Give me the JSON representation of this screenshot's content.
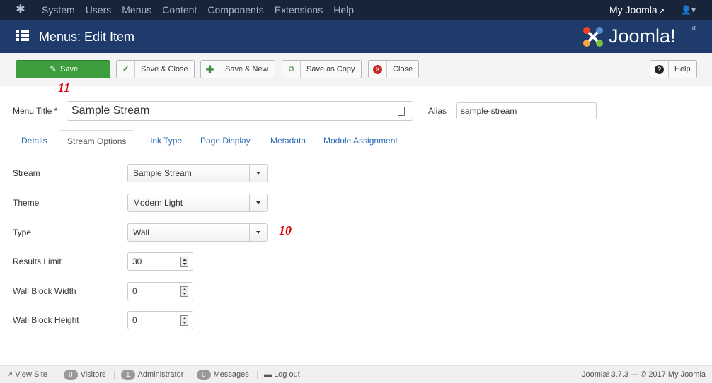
{
  "topnav": {
    "menu": [
      "System",
      "Users",
      "Menus",
      "Content",
      "Components",
      "Extensions",
      "Help"
    ],
    "site_link": "My Joomla",
    "icons": {
      "logo": "joomla-logo-icon",
      "external": "external-link-icon",
      "user": "user-icon"
    }
  },
  "header": {
    "title": "Menus: Edit Item",
    "brand": "Joomla!"
  },
  "toolbar": {
    "save": "Save",
    "save_close": "Save & Close",
    "save_new": "Save & New",
    "save_copy": "Save as Copy",
    "close": "Close",
    "help": "Help"
  },
  "annotations": {
    "save_marker": "11",
    "type_marker": "10"
  },
  "form": {
    "menu_title_label": "Menu Title *",
    "menu_title_value": "Sample Stream",
    "alias_label": "Alias",
    "alias_value": "sample-stream"
  },
  "tabs": [
    "Details",
    "Stream Options",
    "Link Type",
    "Page Display",
    "Metadata",
    "Module Assignment"
  ],
  "active_tab": "Stream Options",
  "options": {
    "stream": {
      "label": "Stream",
      "value": "Sample Stream"
    },
    "theme": {
      "label": "Theme",
      "value": "Modern Light"
    },
    "type": {
      "label": "Type",
      "value": "Wall"
    },
    "results_limit": {
      "label": "Results Limit",
      "value": "30"
    },
    "wall_block_width": {
      "label": "Wall Block Width",
      "value": "0"
    },
    "wall_block_height": {
      "label": "Wall Block Height",
      "value": "0"
    }
  },
  "status": {
    "view_site": "View Site",
    "visitors_count": "0",
    "visitors": "Visitors",
    "admin_count": "1",
    "admin": "Administrator",
    "messages_count": "0",
    "messages": "Messages",
    "logout": "Log out",
    "version": "Joomla! 3.7.3",
    "copyright": "— © 2017 My Joomla"
  },
  "colors": {
    "topnav": "#17243a",
    "header": "#1f3b6b",
    "save": "#3d9e3d",
    "link": "#2a69b8",
    "annotation": "#dd0000"
  }
}
